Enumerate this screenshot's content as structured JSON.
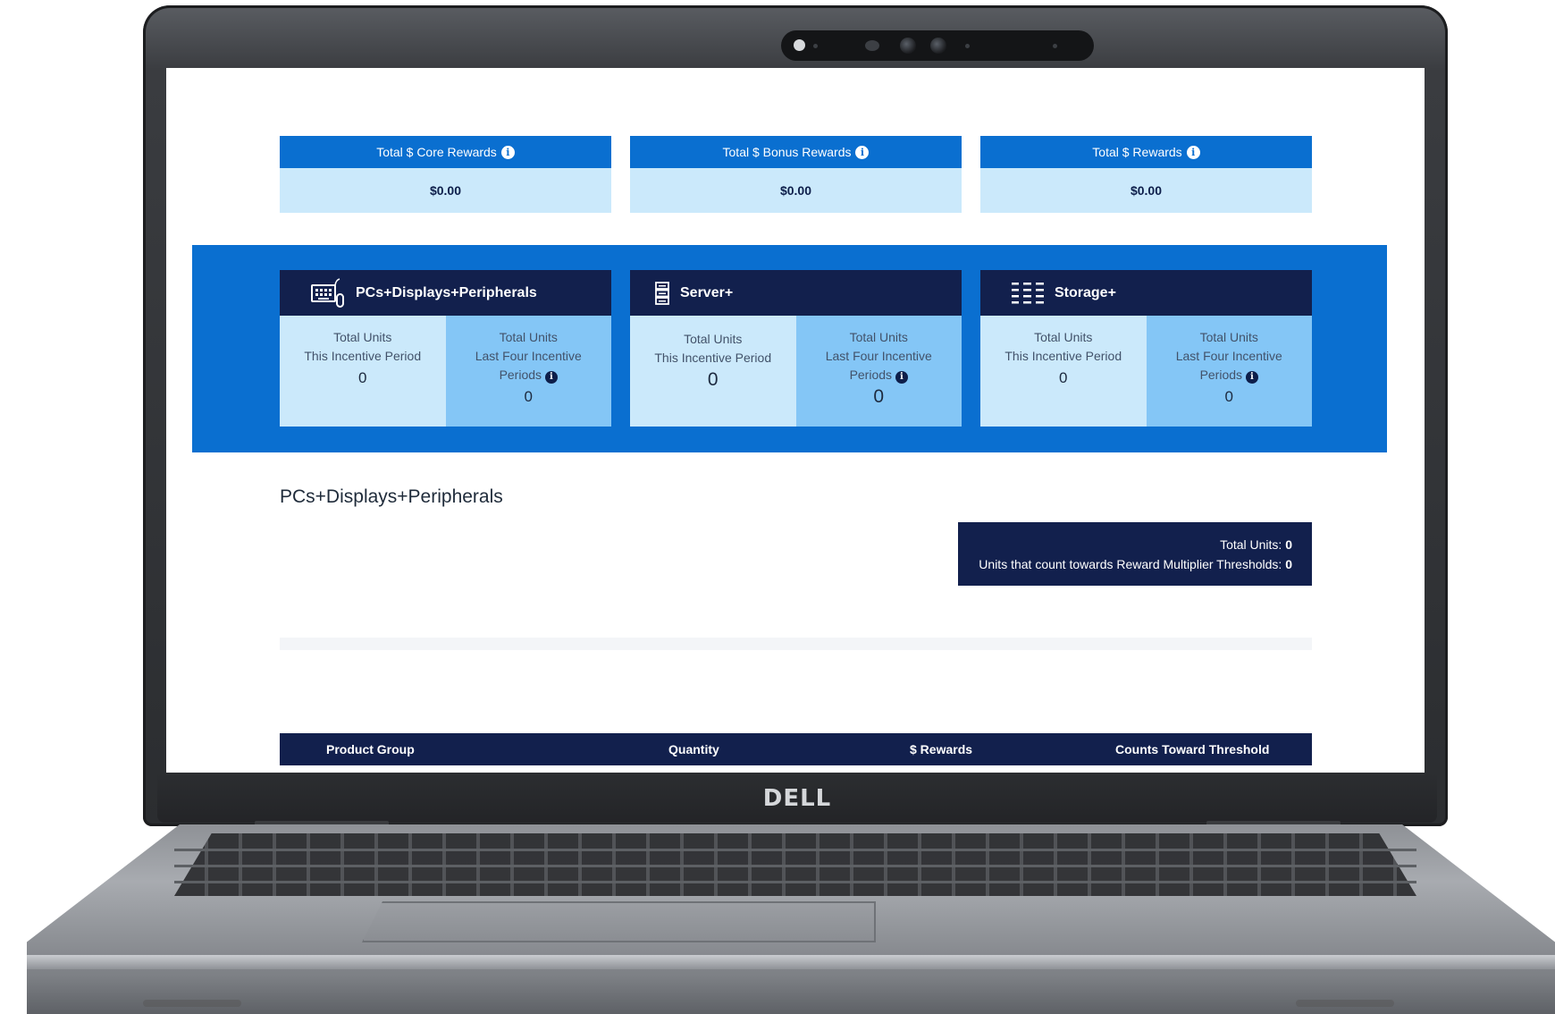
{
  "device": {
    "logo": "DELL"
  },
  "summary": [
    {
      "label": "Total $ Core Rewards",
      "value": "$0.00"
    },
    {
      "label": "Total $ Bonus Rewards",
      "value": "$0.00"
    },
    {
      "label": "Total $ Rewards",
      "value": "$0.00"
    }
  ],
  "categories": [
    {
      "name": "PCs+Displays+Peripherals",
      "icon": "keyboard-mouse-icon",
      "period_label_line1": "Total Units",
      "period_label_line2": "This Incentive Period",
      "period_value": "0",
      "four_label_line1": "Total Units",
      "four_label_line2": "Last Four Incentive",
      "four_label_line3": "Periods",
      "four_value": "0"
    },
    {
      "name": "Server+",
      "icon": "server-icon",
      "period_label_line1": "Total Units",
      "period_label_line2": "This Incentive Period",
      "period_value": "0",
      "four_label_line1": "Total Units",
      "four_label_line2": "Last Four Incentive",
      "four_label_line3": "Periods",
      "four_value": "0"
    },
    {
      "name": "Storage+",
      "icon": "storage-array-icon",
      "period_label_line1": "Total Units",
      "period_label_line2": "This Incentive Period",
      "period_value": "0",
      "four_label_line1": "Total Units",
      "four_label_line2": "Last Four Incentive",
      "four_label_line3": "Periods",
      "four_value": "0"
    }
  ],
  "section": {
    "title": "PCs+Displays+Peripherals",
    "total_units_label": "Total Units:",
    "total_units_value": "0",
    "threshold_units_label": "Units that count towards Reward Multiplier Thresholds:",
    "threshold_units_value": "0"
  },
  "table": {
    "columns": [
      "Product Group",
      "Quantity",
      "$ Rewards",
      "Counts Toward Threshold"
    ]
  },
  "colors": {
    "primary_blue": "#0a6fd0",
    "navy": "#12204d",
    "light_blue": "#cbe9fb",
    "mid_blue": "#84c6f6"
  }
}
